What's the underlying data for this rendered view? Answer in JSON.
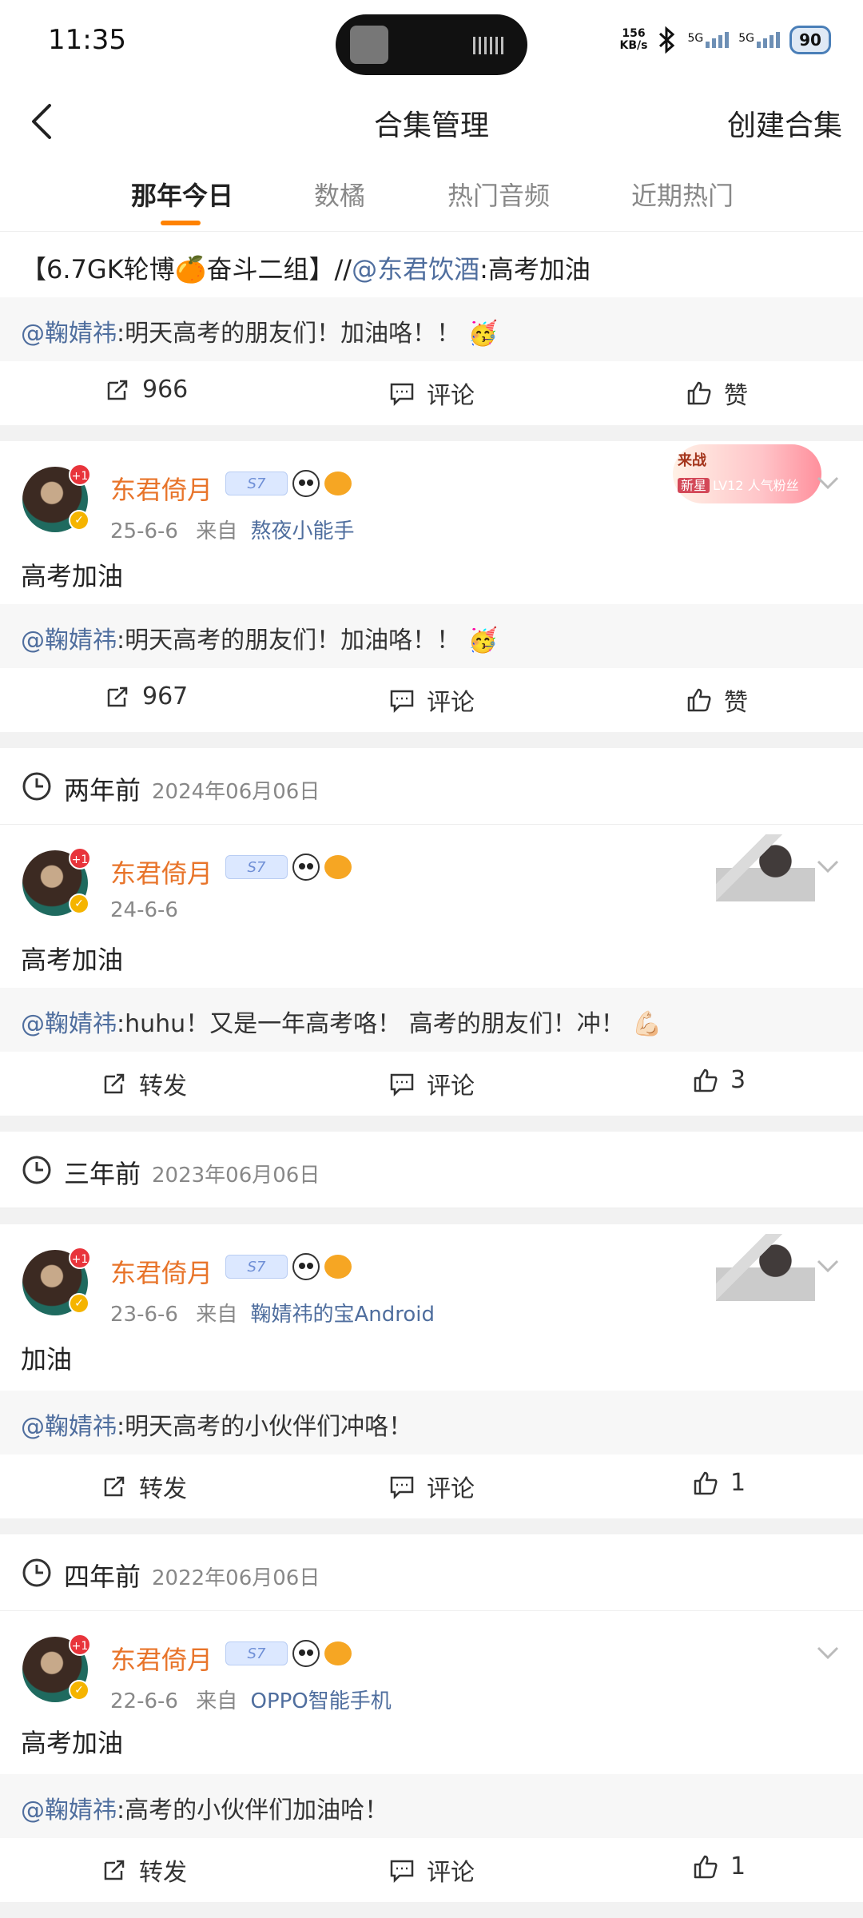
{
  "status_bar": {
    "time": "11:35",
    "net_speed_value": "156",
    "net_speed_unit": "KB/s",
    "sim1": "5G",
    "sim2": "5G",
    "battery": "90"
  },
  "nav": {
    "title": "合集管理",
    "action": "创建合集"
  },
  "tabs": [
    {
      "label": "那年今日",
      "active": true
    },
    {
      "label": "数橘",
      "active": false
    },
    {
      "label": "热门音频",
      "active": false
    },
    {
      "label": "近期热门",
      "active": false
    }
  ],
  "post0": {
    "text_before": "【6.7GK轮博🍊奋斗二组】//",
    "text_mention": "@东君饮酒",
    "text_after": ":高考加油",
    "quote_mention": "@鞠婧祎",
    "quote_text": ":明天高考的朋友们！加油咯！！ 🥳",
    "repost": "966",
    "comment": "评论",
    "like": "赞"
  },
  "post1": {
    "username": "东君倚月",
    "level": "S7",
    "badge_plus": "+1",
    "date": "25-6-6",
    "from_label": "来自",
    "source": "熬夜小能手",
    "fan_badge_title": "来战",
    "fan_badge_tag": "新星",
    "fan_badge_level": "LV12 人气粉丝",
    "text": "高考加油",
    "quote_mention": "@鞠婧祎",
    "quote_text": ":明天高考的朋友们！加油咯！！ 🥳",
    "repost": "967",
    "comment": "评论",
    "like": "赞"
  },
  "sec2": {
    "rel": "两年前",
    "abs": "2024年06月06日"
  },
  "post2": {
    "username": "东君倚月",
    "level": "S7",
    "badge_plus": "+1",
    "date": "24-6-6",
    "text": "高考加油",
    "quote_mention": "@鞠婧祎",
    "quote_text": ":huhu！又是一年高考咯！ 高考的朋友们！冲！ 💪🏻",
    "repost": "转发",
    "comment": "评论",
    "like": "3"
  },
  "sec3": {
    "rel": "三年前",
    "abs": "2023年06月06日"
  },
  "post3": {
    "username": "东君倚月",
    "level": "S7",
    "badge_plus": "+1",
    "date": "23-6-6",
    "from_label": "来自",
    "source": "鞠婧祎的宝Android",
    "text": "加油",
    "quote_mention": "@鞠婧祎",
    "quote_text": ":明天高考的小伙伴们冲咯！",
    "repost": "转发",
    "comment": "评论",
    "like": "1"
  },
  "sec4": {
    "rel": "四年前",
    "abs": "2022年06月06日"
  },
  "post4": {
    "username": "东君倚月",
    "level": "S7",
    "badge_plus": "+1",
    "date": "22-6-6",
    "from_label": "来自",
    "source": "OPPO智能手机",
    "text": "高考加油",
    "quote_mention": "@鞠婧祎",
    "quote_text": ":高考的小伙伴们加油哈！",
    "repost": "转发",
    "comment": "评论",
    "like": "1"
  },
  "colors": {
    "accent": "#ff8200",
    "username": "#e8742a",
    "mention": "#4f6e9e",
    "separator": "#f2f2f2"
  }
}
